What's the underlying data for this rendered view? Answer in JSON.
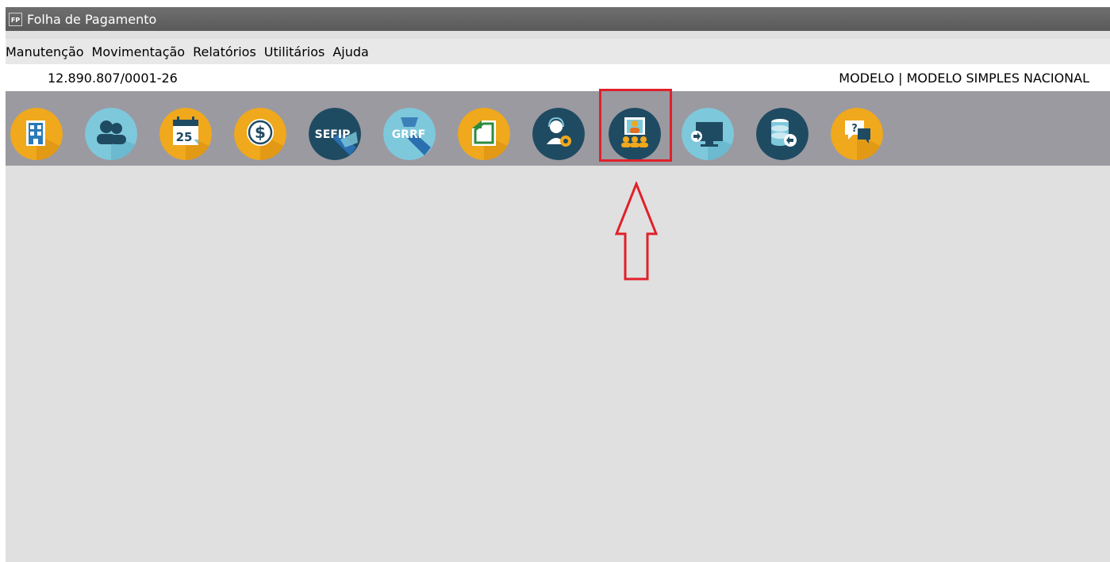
{
  "window": {
    "title": "Folha de Pagamento",
    "app_icon_label": "FP"
  },
  "menu": {
    "items": [
      "Manutenção",
      "Movimentação",
      "Relatórios",
      "Utilitários",
      "Ajuda"
    ]
  },
  "info": {
    "cnpj": "12.890.807/0001-26",
    "company": "MODELO | MODELO SIMPLES NACIONAL"
  },
  "toolbar": {
    "items": [
      {
        "icon": "building-icon",
        "color": "#f0a81c"
      },
      {
        "icon": "users-icon",
        "color": "#7ec8dc"
      },
      {
        "icon": "calendar-icon",
        "color": "#f0a81c",
        "label": "25"
      },
      {
        "icon": "dollar-icon",
        "color": "#f0a81c",
        "label": "$"
      },
      {
        "icon": "sefip-icon",
        "color": "#1f4b62",
        "label": "SEFIP"
      },
      {
        "icon": "grrf-icon",
        "color": "#7ec8dc",
        "label": "GRRF"
      },
      {
        "icon": "document-icon",
        "color": "#f0a81c"
      },
      {
        "icon": "support-settings-icon",
        "color": "#1f4b62"
      },
      {
        "icon": "video-conference-icon",
        "color": "#1f4b62"
      },
      {
        "icon": "monitor-export-icon",
        "color": "#7ec8dc"
      },
      {
        "icon": "database-import-icon",
        "color": "#1f4b62"
      },
      {
        "icon": "help-chat-icon",
        "color": "#f0a81c",
        "label": "?"
      }
    ]
  },
  "annotation": {
    "highlight_color": "#e0202a"
  }
}
